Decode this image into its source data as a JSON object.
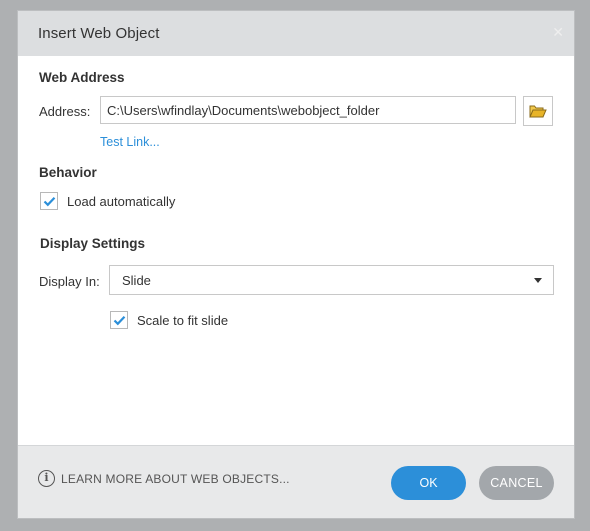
{
  "dialog": {
    "title": "Insert Web Object",
    "close_glyph": "✕"
  },
  "web_address": {
    "heading": "Web Address",
    "address_label": "Address:",
    "address_value": "C:\\Users\\wfindlay\\Documents\\webobject_folder",
    "browse_icon": "folder-open-icon",
    "test_link_label": "Test Link..."
  },
  "behavior": {
    "heading": "Behavior",
    "load_automatically_label": "Load automatically",
    "load_automatically_checked": true
  },
  "display_settings": {
    "heading": "Display Settings",
    "display_in_label": "Display In:",
    "display_in_value": "Slide",
    "scale_to_fit_label": "Scale to fit slide",
    "scale_to_fit_checked": true
  },
  "footer": {
    "learn_more_label": "LEARN MORE ABOUT WEB OBJECTS...",
    "info_glyph": "i",
    "ok_label": "OK",
    "cancel_label": "CANCEL"
  },
  "colors": {
    "accent": "#2c8fd9",
    "folder_icon": "#e8b428",
    "cancel_button": "#a3a7ab",
    "title_bar": "#dcdee0",
    "footer": "#e8e9ea"
  }
}
